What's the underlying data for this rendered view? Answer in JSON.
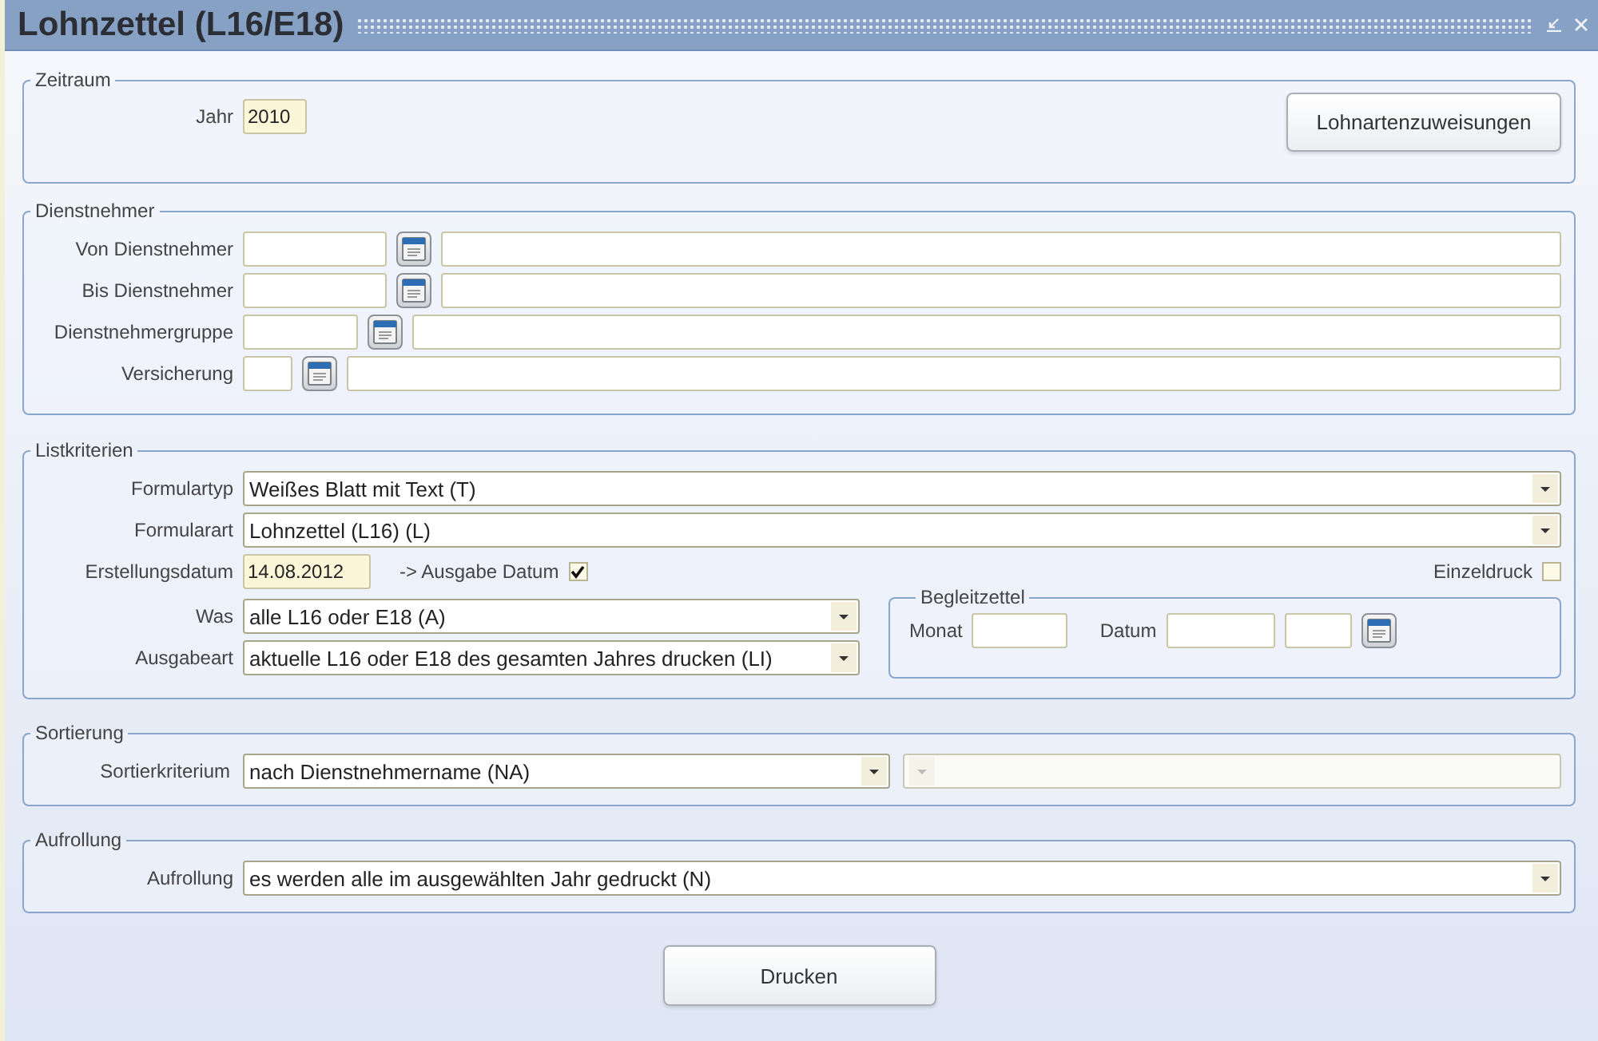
{
  "window": {
    "title": "Lohnzettel (L16/E18)"
  },
  "zeitraum": {
    "legend": "Zeitraum",
    "year_label": "Jahr",
    "year_value": "2010",
    "button": "Lohnartenzuweisungen"
  },
  "dienstnehmer": {
    "legend": "Dienstnehmer",
    "rows": [
      {
        "label": "Von Dienstnehmer"
      },
      {
        "label": "Bis Dienstnehmer"
      },
      {
        "label": "Dienstnehmergruppe"
      },
      {
        "label": "Versicherung"
      }
    ]
  },
  "listkriterien": {
    "legend": "Listkriterien",
    "formulartyp": {
      "label": "Formulartyp",
      "value": "Weißes Blatt mit Text (T)"
    },
    "formularart": {
      "label": "Formularart",
      "value": "Lohnzettel (L16) (L)"
    },
    "erstellungsdatum": {
      "label": "Erstellungsdatum",
      "value": "14.08.2012"
    },
    "ausgabe_datum": {
      "label": "-> Ausgabe Datum",
      "checked": true
    },
    "einzeldruck": {
      "label": "Einzeldruck",
      "checked": false
    },
    "was": {
      "label": "Was",
      "value": "alle L16 oder E18 (A)"
    },
    "ausgabeart": {
      "label": "Ausgabeart",
      "value": "aktuelle L16 oder E18 des gesamten Jahres drucken (LI)"
    },
    "begleitzettel": {
      "legend": "Begleitzettel",
      "monat_label": "Monat",
      "datum_label": "Datum"
    }
  },
  "sortierung": {
    "legend": "Sortierung",
    "label": "Sortierkriterium",
    "value": "nach Dienstnehmername (NA)",
    "second_disabled": true
  },
  "aufrollung": {
    "legend": "Aufrollung",
    "label": "Aufrollung",
    "value": "es werden alle im ausgewählten Jahr gedruckt (N)"
  },
  "print_button": "Drucken"
}
